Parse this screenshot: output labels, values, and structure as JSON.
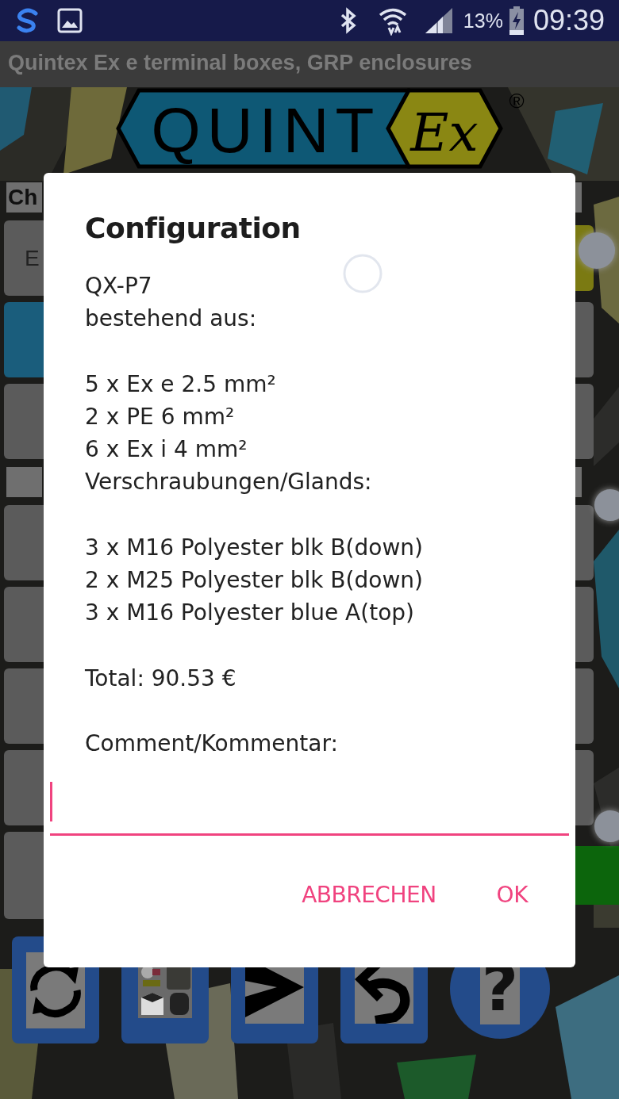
{
  "status_bar": {
    "battery": "13%",
    "time": "09:39"
  },
  "title_bar": {
    "title": "Quintex Ex e terminal boxes, GRP enclosures"
  },
  "logo": {
    "word": "QUINT",
    "mark": "Ex",
    "registered": "®"
  },
  "background": {
    "rows": [
      {
        "kind": "header",
        "label": "Ch"
      },
      {
        "kind": "buttons",
        "left": {
          "kind": "plain",
          "label": "E"
        },
        "right": {
          "kind": "highlight"
        }
      },
      {
        "kind": "buttons",
        "left": {
          "kind": "active"
        },
        "right": {
          "kind": "plain"
        }
      },
      {
        "kind": "buttons",
        "left": {
          "kind": "plain"
        },
        "right": {
          "kind": "plain"
        }
      },
      {
        "kind": "header"
      },
      {
        "kind": "buttons",
        "left": {
          "kind": "plain"
        },
        "right": {
          "kind": "plain"
        }
      },
      {
        "kind": "buttons",
        "left": {
          "kind": "plain"
        },
        "right": {
          "kind": "plain"
        }
      },
      {
        "kind": "buttons",
        "left": {
          "kind": "plain"
        },
        "right": {
          "kind": "plain"
        }
      },
      {
        "kind": "buttons",
        "left": {
          "kind": "plain"
        },
        "right": {
          "kind": "plain"
        }
      },
      {
        "kind": "buttons",
        "left": {
          "kind": "plain"
        },
        "right": {
          "kind": "confirm"
        }
      }
    ],
    "toolbar": [
      {
        "kind": "refresh"
      },
      {
        "kind": "thumbnail"
      },
      {
        "kind": "send"
      },
      {
        "kind": "undo"
      },
      {
        "kind": "help",
        "label": "?"
      }
    ]
  },
  "dialog": {
    "title": "Configuration",
    "paragraphs": [
      [
        "QX-P7",
        "bestehend aus:"
      ],
      [
        "5 x Ex e 2.5 mm²",
        "2 x PE 6 mm²",
        "6 x Ex i 4 mm²",
        "Verschraubungen/Glands:"
      ],
      [
        "3 x M16 Polyester blk B(down)",
        "2 x M25 Polyester blk B(down)",
        "3 x M16 Polyester blue A(top)"
      ],
      [
        "Total: 90.53 €"
      ],
      [
        "Comment/Kommentar:"
      ]
    ],
    "comment": {
      "focused": true
    },
    "buttons": [
      "ABBRECHEN",
      "OK"
    ]
  }
}
